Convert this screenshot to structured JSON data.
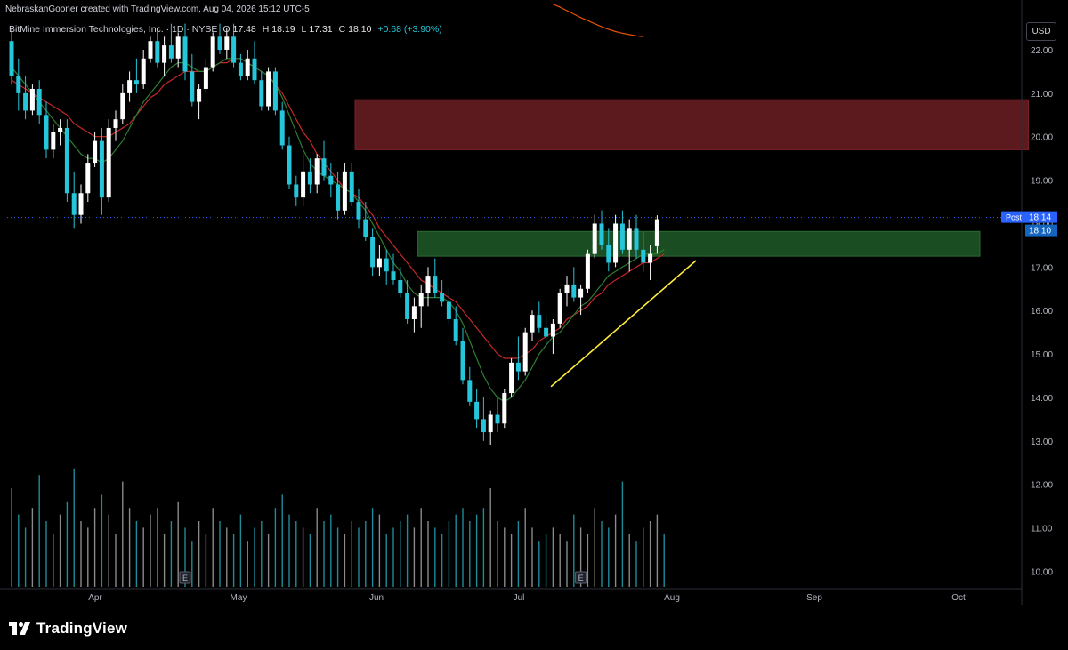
{
  "header": {
    "attribution": "NebraskanGooner created with TradingView.com, Aug 04, 2026 15:12 UTC-5"
  },
  "legend": {
    "symbol_name": "BitMine Immersion Technologies, Inc. · 1D · NYSE",
    "open_label": "O",
    "open": "17.48",
    "high_label": "H",
    "high": "18.19",
    "low_label": "L",
    "low": "17.31",
    "close_label": "C",
    "close": "18.10",
    "change": "+0.68 (+3.90%)"
  },
  "price_axis": {
    "currency_button": "USD",
    "post_label": "Post",
    "post_value": "18.14",
    "last_value": "18.10"
  },
  "brand": {
    "name": "TradingView"
  },
  "colors": {
    "background": "#000000",
    "up_candle": "#ffffff",
    "down_candle": "#26c6da",
    "ma_fast": "#2e7d32",
    "ma_slow": "#c62828",
    "ma_long": "#e65100",
    "resistance_zone": "#5c1a1f",
    "support_zone": "#1b4d22",
    "trendline": "#ffeb3b",
    "axis_text": "#b2b5be"
  },
  "chart_data": {
    "type": "candlestick",
    "ylim": [
      9.6,
      22.9
    ],
    "y_ticks": [
      10.0,
      11.0,
      12.0,
      13.0,
      14.0,
      15.0,
      16.0,
      17.0,
      18.0,
      19.0,
      20.0,
      21.0,
      22.0
    ],
    "x_ticks": [
      "Apr",
      "May",
      "Jun",
      "Jul",
      "Aug",
      "Sep",
      "Oct"
    ],
    "candles": [
      [
        22.2,
        22.5,
        21.2,
        21.4
      ],
      [
        21.4,
        21.8,
        20.6,
        21.0
      ],
      [
        21.0,
        21.4,
        20.4,
        20.6
      ],
      [
        20.6,
        21.2,
        20.5,
        21.1
      ],
      [
        21.1,
        21.3,
        20.3,
        20.5
      ],
      [
        20.5,
        20.8,
        19.5,
        19.7
      ],
      [
        19.7,
        20.3,
        19.5,
        20.1
      ],
      [
        20.1,
        20.4,
        19.8,
        20.2
      ],
      [
        20.2,
        20.4,
        18.5,
        18.7
      ],
      [
        18.7,
        19.2,
        17.9,
        18.2
      ],
      [
        18.2,
        18.9,
        18.0,
        18.7
      ],
      [
        18.7,
        19.6,
        18.5,
        19.4
      ],
      [
        19.4,
        20.1,
        19.3,
        19.9
      ],
      [
        19.9,
        20.2,
        18.2,
        18.6
      ],
      [
        18.6,
        20.4,
        18.5,
        20.2
      ],
      [
        20.2,
        20.6,
        19.9,
        20.4
      ],
      [
        20.4,
        21.2,
        20.3,
        21.0
      ],
      [
        21.0,
        21.5,
        20.8,
        21.3
      ],
      [
        21.3,
        21.8,
        21.0,
        21.2
      ],
      [
        21.2,
        22.0,
        21.1,
        21.8
      ],
      [
        21.8,
        22.3,
        21.7,
        22.2
      ],
      [
        22.2,
        22.5,
        21.6,
        21.7
      ],
      [
        21.7,
        22.3,
        21.4,
        22.1
      ],
      [
        22.1,
        22.6,
        21.7,
        21.8
      ],
      [
        21.8,
        22.4,
        21.6,
        22.3
      ],
      [
        22.3,
        22.6,
        21.3,
        21.5
      ],
      [
        21.5,
        21.9,
        20.7,
        20.8
      ],
      [
        20.8,
        21.2,
        20.4,
        21.1
      ],
      [
        21.1,
        21.8,
        21.0,
        21.6
      ],
      [
        21.6,
        22.4,
        21.5,
        22.3
      ],
      [
        22.3,
        22.6,
        21.9,
        22.0
      ],
      [
        22.0,
        22.5,
        21.8,
        22.3
      ],
      [
        22.3,
        22.6,
        21.6,
        21.7
      ],
      [
        21.7,
        21.9,
        21.3,
        21.4
      ],
      [
        21.4,
        22.0,
        21.3,
        21.8
      ],
      [
        21.8,
        22.2,
        21.2,
        21.3
      ],
      [
        21.3,
        21.5,
        20.6,
        20.7
      ],
      [
        20.7,
        21.6,
        20.6,
        21.5
      ],
      [
        21.5,
        21.6,
        20.5,
        20.6
      ],
      [
        20.6,
        20.8,
        19.7,
        19.8
      ],
      [
        19.8,
        20.0,
        18.8,
        18.9
      ],
      [
        18.9,
        19.1,
        18.4,
        18.6
      ],
      [
        18.6,
        19.6,
        18.4,
        19.2
      ],
      [
        19.2,
        19.5,
        18.7,
        18.9
      ],
      [
        18.9,
        19.6,
        18.7,
        19.5
      ],
      [
        19.5,
        19.9,
        19.0,
        19.1
      ],
      [
        19.1,
        19.4,
        18.6,
        18.9
      ],
      [
        18.9,
        19.2,
        18.1,
        18.3
      ],
      [
        18.3,
        19.4,
        18.2,
        19.2
      ],
      [
        19.2,
        19.4,
        18.4,
        18.5
      ],
      [
        18.5,
        18.8,
        17.9,
        18.1
      ],
      [
        18.1,
        18.5,
        17.6,
        17.7
      ],
      [
        17.7,
        17.9,
        16.8,
        17.0
      ],
      [
        17.0,
        17.5,
        16.8,
        17.2
      ],
      [
        17.2,
        17.4,
        16.6,
        16.9
      ],
      [
        16.9,
        17.3,
        16.6,
        16.7
      ],
      [
        16.7,
        17.0,
        16.3,
        16.4
      ],
      [
        16.4,
        16.7,
        15.7,
        15.8
      ],
      [
        15.8,
        16.3,
        15.5,
        16.1
      ],
      [
        16.1,
        16.6,
        15.6,
        16.4
      ],
      [
        16.4,
        17.0,
        16.1,
        16.8
      ],
      [
        16.8,
        17.2,
        16.3,
        16.4
      ],
      [
        16.4,
        16.7,
        16.1,
        16.2
      ],
      [
        16.2,
        16.5,
        15.7,
        15.8
      ],
      [
        15.8,
        16.1,
        15.2,
        15.3
      ],
      [
        15.3,
        15.6,
        14.3,
        14.4
      ],
      [
        14.4,
        14.7,
        13.8,
        13.9
      ],
      [
        13.9,
        14.2,
        13.3,
        13.5
      ],
      [
        13.5,
        14.0,
        13.0,
        13.2
      ],
      [
        13.2,
        13.7,
        12.9,
        13.6
      ],
      [
        13.6,
        14.0,
        13.2,
        13.4
      ],
      [
        13.4,
        14.2,
        13.3,
        14.1
      ],
      [
        14.1,
        14.9,
        14.0,
        14.8
      ],
      [
        14.8,
        15.4,
        14.4,
        14.6
      ],
      [
        14.6,
        15.6,
        14.5,
        15.5
      ],
      [
        15.5,
        16.0,
        15.3,
        15.9
      ],
      [
        15.9,
        16.2,
        15.5,
        15.6
      ],
      [
        15.6,
        15.9,
        15.2,
        15.4
      ],
      [
        15.4,
        15.8,
        15.0,
        15.7
      ],
      [
        15.7,
        16.5,
        15.6,
        16.4
      ],
      [
        16.4,
        16.8,
        16.1,
        16.6
      ],
      [
        16.6,
        17.0,
        16.2,
        16.3
      ],
      [
        16.3,
        16.6,
        15.9,
        16.5
      ],
      [
        16.5,
        17.4,
        16.4,
        17.3
      ],
      [
        17.3,
        18.2,
        17.2,
        18.0
      ],
      [
        18.0,
        18.3,
        17.4,
        17.5
      ],
      [
        17.5,
        17.9,
        16.9,
        17.1
      ],
      [
        17.1,
        18.2,
        17.0,
        18.0
      ],
      [
        18.0,
        18.3,
        17.3,
        17.4
      ],
      [
        17.4,
        18.1,
        16.9,
        17.9
      ],
      [
        17.9,
        18.2,
        17.2,
        17.4
      ],
      [
        17.4,
        17.8,
        16.9,
        17.1
      ],
      [
        17.1,
        17.5,
        16.7,
        17.3
      ],
      [
        17.48,
        18.19,
        17.31,
        18.1
      ]
    ],
    "volume_relative": [
      0.75,
      0.55,
      0.45,
      0.6,
      0.85,
      0.5,
      0.4,
      0.55,
      0.65,
      0.9,
      0.5,
      0.45,
      0.6,
      0.7,
      0.55,
      0.4,
      0.8,
      0.6,
      0.5,
      0.45,
      0.55,
      0.6,
      0.4,
      0.5,
      0.65,
      0.45,
      0.35,
      0.5,
      0.4,
      0.6,
      0.5,
      0.45,
      0.4,
      0.55,
      0.35,
      0.45,
      0.5,
      0.4,
      0.6,
      0.7,
      0.55,
      0.5,
      0.45,
      0.4,
      0.6,
      0.5,
      0.55,
      0.45,
      0.4,
      0.5,
      0.45,
      0.5,
      0.6,
      0.55,
      0.4,
      0.45,
      0.5,
      0.55,
      0.45,
      0.6,
      0.5,
      0.45,
      0.4,
      0.5,
      0.55,
      0.6,
      0.5,
      0.55,
      0.6,
      0.75,
      0.5,
      0.45,
      0.4,
      0.5,
      0.6,
      0.45,
      0.35,
      0.4,
      0.45,
      0.4,
      0.35,
      0.55,
      0.45,
      0.4,
      0.6,
      0.5,
      0.45,
      0.55,
      0.8,
      0.4,
      0.35,
      0.45,
      0.5,
      0.55,
      0.4
    ],
    "ma_fast": [
      21.6,
      21.4,
      21.2,
      21.0,
      20.8,
      20.6,
      20.4,
      20.2,
      20.0,
      19.8,
      19.6,
      19.5,
      19.5,
      19.4,
      19.5,
      19.7,
      19.9,
      20.2,
      20.5,
      20.8,
      21.0,
      21.2,
      21.4,
      21.6,
      21.7,
      21.7,
      21.6,
      21.5,
      21.5,
      21.6,
      21.7,
      21.8,
      21.8,
      21.8,
      21.7,
      21.6,
      21.5,
      21.4,
      21.2,
      20.9,
      20.5,
      20.1,
      19.7,
      19.4,
      19.2,
      19.1,
      19.0,
      18.9,
      18.8,
      18.7,
      18.5,
      18.3,
      18.0,
      17.7,
      17.4,
      17.1,
      16.9,
      16.6,
      16.4,
      16.3,
      16.3,
      16.3,
      16.3,
      16.2,
      16.0,
      15.7,
      15.3,
      14.9,
      14.5,
      14.2,
      14.0,
      13.9,
      14.0,
      14.2,
      14.4,
      14.7,
      15.0,
      15.2,
      15.4,
      15.5,
      15.7,
      15.9,
      16.1,
      16.2,
      16.4,
      16.6,
      16.8,
      16.9,
      17.0,
      17.1,
      17.2,
      17.3,
      17.3,
      17.3,
      17.4
    ],
    "ma_slow": [
      21.3,
      21.2,
      21.1,
      21.0,
      20.9,
      20.8,
      20.7,
      20.6,
      20.5,
      20.3,
      20.2,
      20.1,
      20.0,
      20.0,
      20.0,
      20.1,
      20.2,
      20.3,
      20.5,
      20.7,
      20.9,
      21.0,
      21.2,
      21.3,
      21.4,
      21.5,
      21.5,
      21.5,
      21.5,
      21.6,
      21.7,
      21.7,
      21.8,
      21.8,
      21.7,
      21.6,
      21.5,
      21.4,
      21.2,
      21.0,
      20.7,
      20.4,
      20.1,
      19.9,
      19.6,
      19.4,
      19.2,
      19.0,
      18.8,
      18.7,
      18.6,
      18.4,
      18.2,
      17.9,
      17.7,
      17.5,
      17.3,
      17.1,
      16.9,
      16.7,
      16.6,
      16.5,
      16.4,
      16.3,
      16.2,
      16.0,
      15.8,
      15.6,
      15.4,
      15.2,
      15.0,
      14.9,
      14.9,
      14.9,
      15.0,
      15.1,
      15.3,
      15.4,
      15.5,
      15.6,
      15.8,
      15.9,
      16.0,
      16.1,
      16.3,
      16.4,
      16.6,
      16.7,
      16.8,
      16.9,
      17.0,
      17.1,
      17.1,
      17.2,
      17.3
    ],
    "ma_long_segment": {
      "start_index": 78,
      "values": [
        23.05,
        22.98,
        22.9,
        22.82,
        22.74,
        22.67,
        22.6,
        22.53,
        22.47,
        22.42,
        22.38,
        22.35,
        22.32,
        22.3
      ]
    },
    "resistance_zone": {
      "from_index": 50,
      "to_index": 147,
      "low": 19.7,
      "high": 20.85
    },
    "support_zone": {
      "from_index": 59,
      "to_index": 140,
      "low": 17.25,
      "high": 17.82
    },
    "trendline": {
      "from_index": 77.7,
      "from_price": 14.25,
      "to_index": 98.6,
      "to_price": 17.15
    },
    "earnings_markers": [
      {
        "index": 25,
        "label": "E"
      },
      {
        "index": 82,
        "label": "E"
      }
    ],
    "reference_price": 18.14
  }
}
